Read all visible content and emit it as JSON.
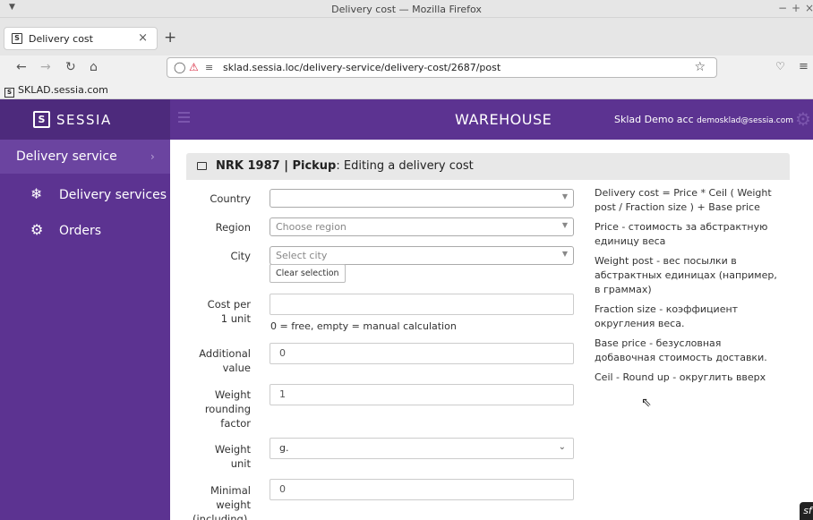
{
  "browser": {
    "window_title": "Delivery cost — Mozilla Firefox",
    "window_controls": [
      "−",
      "+",
      "×"
    ],
    "tab": {
      "title": "Delivery cost",
      "close": "×"
    },
    "new_tab": "+",
    "url": "sklad.sessia.loc/delivery-service/delivery-cost/2687/post",
    "bookmark": "SKLAD.sessia.com"
  },
  "header": {
    "logo_mark": "S",
    "logo_text": "SESSIA",
    "section": "WAREHOUSE",
    "account_name": "Sklad Demo acc",
    "account_email": "demosklad@sessia.com"
  },
  "sidebar": {
    "group": "Delivery service",
    "items": [
      {
        "label": "Delivery services",
        "icon": "cubes-icon"
      },
      {
        "label": "Orders",
        "icon": "gear-icon"
      }
    ]
  },
  "panel": {
    "title_bold": "NRK 1987 | Pickup",
    "title_rest": ": Editing a delivery cost"
  },
  "form": {
    "country": {
      "label": "Country",
      "value": ""
    },
    "region": {
      "label": "Region",
      "placeholder": "Choose region"
    },
    "city": {
      "label": "City",
      "placeholder": "Select city",
      "clear_label": "Clear selection"
    },
    "cost_per_unit": {
      "label_1": "Cost per",
      "label_2": "1 unit",
      "value": "",
      "help": "0 = free, empty = manual calculation"
    },
    "additional_value": {
      "label_1": "Additional",
      "label_2": "value",
      "value": "0"
    },
    "weight_rounding": {
      "label_1": "Weight",
      "label_2": "rounding",
      "label_3": "factor",
      "value": "1"
    },
    "weight_unit": {
      "label_1": "Weight",
      "label_2": "unit",
      "value": "g."
    },
    "minimal_weight": {
      "label_1": "Minimal",
      "label_2": "weight",
      "label_3": "(including),",
      "value": "0"
    }
  },
  "info": [
    "Delivery cost = Price * Ceil ( Weight post / Fraction size ) + Base price",
    "Price - стоимость за абстрактную единицу веса",
    "Weight post - вес посылки в абстрактных единицах (например, в граммах)",
    "Fraction size - коэффициент округления веса.",
    "Base price - безусловная добавочная стоимость доставки.",
    "Ceil - Round up - округлить вверх"
  ]
}
